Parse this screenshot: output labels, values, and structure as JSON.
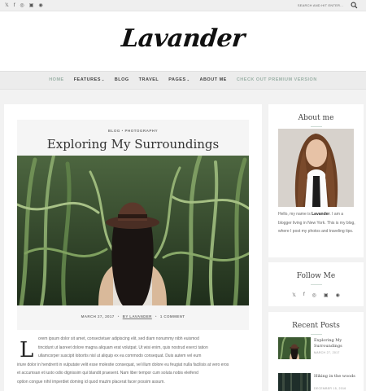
{
  "topbar": {
    "social_icons": [
      "twitter-icon",
      "facebook-icon",
      "instagram-icon",
      "flickr-icon",
      "pinterest-icon"
    ],
    "search_placeholder": "SEARCH AND HIT ENTER..."
  },
  "header": {
    "logo": "Lavander"
  },
  "nav": {
    "items": [
      {
        "label": "HOME",
        "muted": true
      },
      {
        "label": "FEATURES",
        "dropdown": true
      },
      {
        "label": "BLOG"
      },
      {
        "label": "TRAVEL"
      },
      {
        "label": "PAGES",
        "dropdown": true
      },
      {
        "label": "ABOUT ME"
      },
      {
        "label": "CHECK OUT PREMIUM VERSION",
        "muted": true
      }
    ]
  },
  "post": {
    "categories": "BLOG • PHOTOGRAPHY",
    "title": "Exploring My Surroundings",
    "date": "MARCH 27, 2017",
    "author": "BY LAVANDER",
    "comments": "1 COMMENT",
    "dropcap": "L",
    "excerpt_line1": "orem ipsum dolor sit amet, consectetuer adipiscing elit, sed diam nonummy nibh euismod",
    "excerpt_line2": "tincidunt ut laoreet dolore magna aliquam erat volutpat. Ut wisi enim, quis nostrud exerci tation",
    "excerpt_line3": "ullamcorper suscipit lobortis nisl ut aliquip ex ea commodo consequat. Duis autem vel eum",
    "excerpt_line4": "iriure dolor in hendrerit in vulputate velit esse molestie consequat, vel illum dolore eu feugiat nulla facilisis at vero eros",
    "excerpt_line5": "et accumsan et iusto odio dignissim qui blandit praesent. Nam liber tempor cum soluta nobis eleifend",
    "excerpt_line6": "option congue nihil imperdiet doming id quod mazim placerat facer possim assum."
  },
  "sidebar": {
    "about": {
      "title": "About me",
      "text_pre": "Hello, my name is ",
      "text_name": "Lavander",
      "text_post": ". I am a blogger living in New York. This is my blog, where I post my photos and traveling tips."
    },
    "follow": {
      "title": "Follow Me",
      "icons": [
        "twitter-icon",
        "facebook-icon",
        "instagram-icon",
        "flickr-icon",
        "pinterest-icon"
      ]
    },
    "recent": {
      "title": "Recent Posts",
      "posts": [
        {
          "title": "Exploring My Surroundings",
          "date": "MARCH 27, 2017"
        },
        {
          "title": "Hiking in the woods",
          "date": "DECEMBER 15, 2016"
        }
      ]
    }
  }
}
